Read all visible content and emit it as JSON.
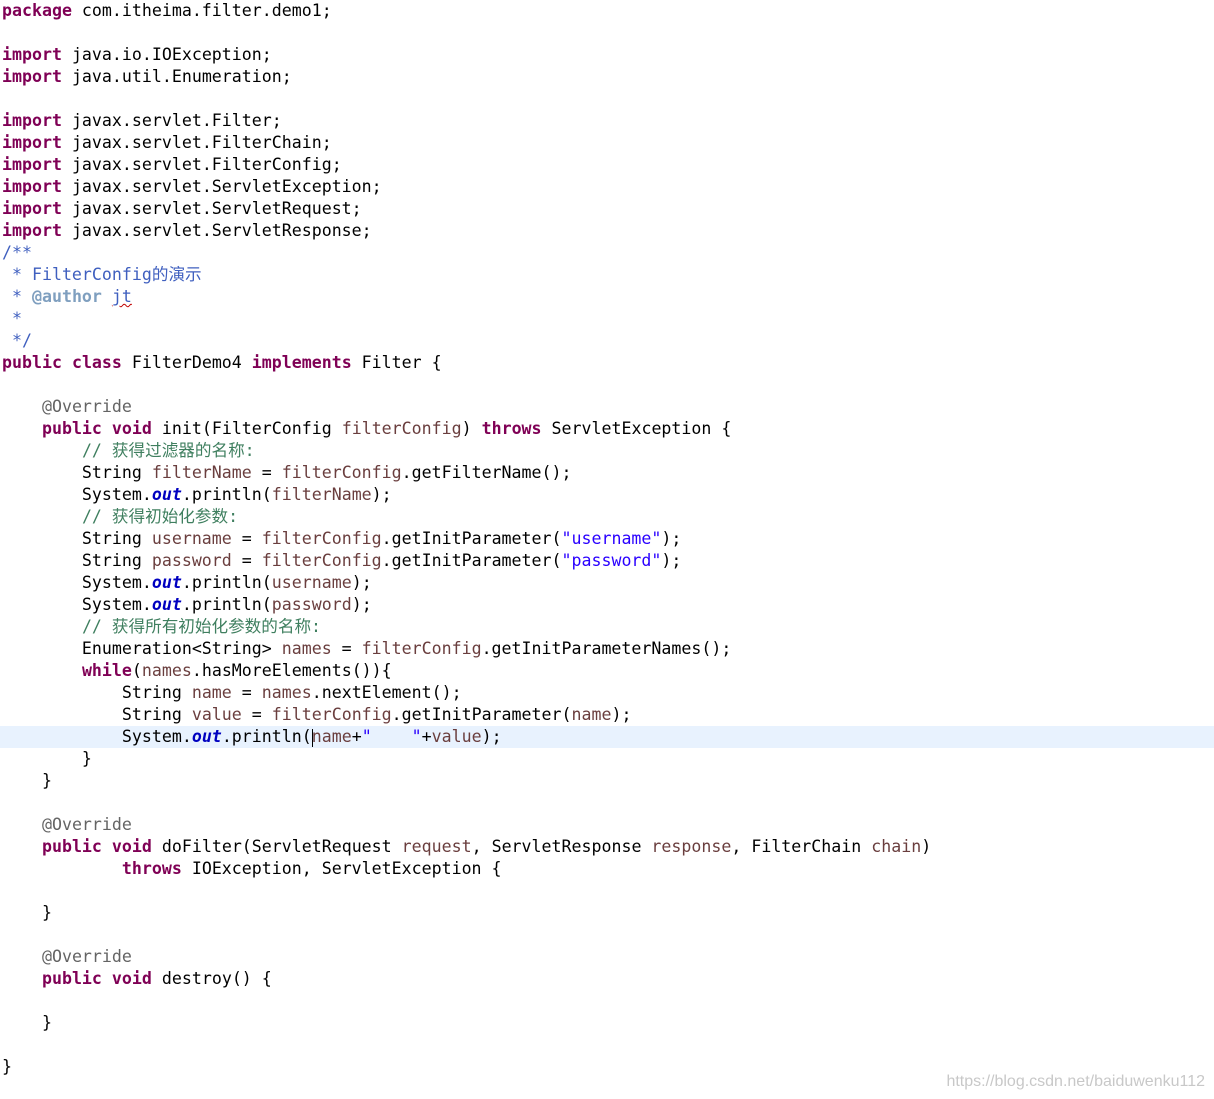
{
  "editor": {
    "l1": [
      "package",
      " com.itheima.filter.demo1;"
    ],
    "l3": [
      "import",
      " java.io.IOException;"
    ],
    "l4": [
      "import",
      " java.util.Enumeration;"
    ],
    "l6": [
      "import",
      " javax.servlet.Filter;"
    ],
    "l7": [
      "import",
      " javax.servlet.FilterChain;"
    ],
    "l8": [
      "import",
      " javax.servlet.FilterConfig;"
    ],
    "l9": [
      "import",
      " javax.servlet.ServletException;"
    ],
    "l10": [
      "import",
      " javax.servlet.ServletRequest;"
    ],
    "l11": [
      "import",
      " javax.servlet.ServletResponse;"
    ],
    "l12": [
      "/**"
    ],
    "l13": [
      " * FilterConfig的演示"
    ],
    "l14": [
      " * ",
      "@author",
      " ",
      "jt"
    ],
    "l15": [
      " *"
    ],
    "l16": [
      " */"
    ],
    "l17": [
      "public",
      " ",
      "class",
      " FilterDemo4 ",
      "implements",
      " Filter {"
    ],
    "l19": [
      "    ",
      "@Override"
    ],
    "l20": [
      "    ",
      "public",
      " ",
      "void",
      " init(FilterConfig ",
      "filterConfig",
      ") ",
      "throws",
      " ServletException {"
    ],
    "l21": [
      "        ",
      "// 获得过滤器的名称:"
    ],
    "l22": [
      "        String ",
      "filterName",
      " = ",
      "filterConfig",
      ".getFilterName();"
    ],
    "l23": [
      "        System.",
      "out",
      ".println(",
      "filterName",
      ");"
    ],
    "l24": [
      "        ",
      "// 获得初始化参数:"
    ],
    "l25": [
      "        String ",
      "username",
      " = ",
      "filterConfig",
      ".getInitParameter(",
      "\"username\"",
      ");"
    ],
    "l26": [
      "        String ",
      "password",
      " = ",
      "filterConfig",
      ".getInitParameter(",
      "\"password\"",
      ");"
    ],
    "l27": [
      "        System.",
      "out",
      ".println(",
      "username",
      ");"
    ],
    "l28": [
      "        System.",
      "out",
      ".println(",
      "password",
      ");"
    ],
    "l29": [
      "        ",
      "// 获得所有初始化参数的名称:"
    ],
    "l30": [
      "        Enumeration<String> ",
      "names",
      " = ",
      "filterConfig",
      ".getInitParameterNames();"
    ],
    "l31": [
      "        ",
      "while",
      "(",
      "names",
      ".hasMoreElements()){"
    ],
    "l32": [
      "            String ",
      "name",
      " = ",
      "names",
      ".nextElement();"
    ],
    "l33": [
      "            String ",
      "value",
      " = ",
      "filterConfig",
      ".getInitParameter(",
      "name",
      ");"
    ],
    "l34": [
      "            System.",
      "out",
      ".println(",
      "name",
      "+",
      "\"    \"",
      "+",
      "value",
      ");"
    ],
    "l35": [
      "        }"
    ],
    "l36": [
      "    }"
    ],
    "l38": [
      "    ",
      "@Override"
    ],
    "l39": [
      "    ",
      "public",
      " ",
      "void",
      " doFilter(ServletRequest ",
      "request",
      ", ServletResponse ",
      "response",
      ", FilterChain ",
      "chain",
      ")"
    ],
    "l40": [
      "            ",
      "throws",
      " IOException, ServletException {"
    ],
    "l42": [
      "    }"
    ],
    "l44": [
      "    ",
      "@Override"
    ],
    "l45": [
      "    ",
      "public",
      " ",
      "void",
      " destroy() {"
    ],
    "l47": [
      "    }"
    ],
    "l49": [
      "}"
    ]
  },
  "colors": {
    "keyword": "#7f0055",
    "annotation": "#646464",
    "javadoc": "#3f5fbf",
    "comment": "#3f7f5f",
    "string": "#2a00ff",
    "static_field": "#0000c0",
    "local_variable": "#6a3e3e",
    "current_line": "#e8f2fe"
  },
  "watermark": "https://blog.csdn.net/baiduwenku112"
}
